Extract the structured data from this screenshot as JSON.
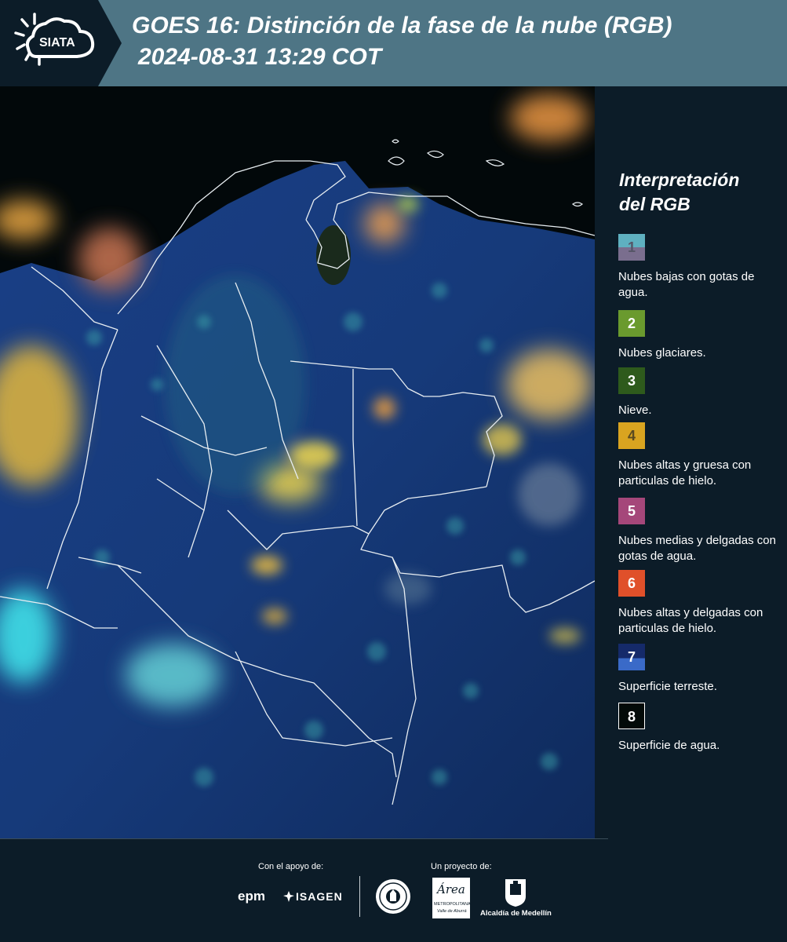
{
  "header": {
    "logo_text": "SIATA",
    "title": "GOES 16: Distinción de la fase de la nube (RGB)",
    "timestamp": "2024-08-31 13:29 COT"
  },
  "legend": {
    "title_line1": "Interpretación",
    "title_line2": "del RGB",
    "items": [
      {
        "number": "1",
        "label": "Nubes bajas con gotas de agua.",
        "color_top": "#5fb0c0",
        "color_bottom": "#7a6e8e",
        "text_color": "#555566"
      },
      {
        "number": "2",
        "label": "Nubes glaciares.",
        "color_top": "#6a9a2e",
        "color_bottom": "#6a9a2e",
        "text_color": "#ffffff"
      },
      {
        "number": "3",
        "label": "Nieve.",
        "color_top": "#2e5a1c",
        "color_bottom": "#2e5a1c",
        "text_color": "#ffffff"
      },
      {
        "number": "4",
        "label": "Nubes altas y gruesa con particulas de hielo.",
        "color_top": "#d9a420",
        "color_bottom": "#d9a420",
        "text_color": "#5a4a20"
      },
      {
        "number": "5",
        "label": "Nubes medias y delgadas con gotas de agua.",
        "color_top": "#a5477a",
        "color_bottom": "#a5477a",
        "text_color": "#ffffff"
      },
      {
        "number": "6",
        "label": "Nubes altas y delgadas con particulas de hielo.",
        "color_top": "#e0502a",
        "color_bottom": "#e0502a",
        "text_color": "#ffffff"
      },
      {
        "number": "7",
        "label": "Superficie terreste.",
        "color_top": "#152a6a",
        "color_bottom": "#3a6ac8",
        "text_color": "#ffffff"
      },
      {
        "number": "8",
        "label": "Superficie de agua.",
        "color_top": "#030a08",
        "color_bottom": "#030a08",
        "text_color": "#ffffff"
      }
    ]
  },
  "footer": {
    "support_label": "Con el apoyo de:",
    "project_label": "Un proyecto de:",
    "sponsor_epm": "epm",
    "sponsor_isagen": "ISAGEN",
    "area_logo_text": "Área",
    "area_sub1": "METROPOLITANA",
    "area_sub2": "Valle de Aburrá",
    "medellin_text": "Alcaldía de Medellín"
  },
  "colors": {
    "header_bg": "#4e7585",
    "page_bg": "#0c1c28"
  }
}
